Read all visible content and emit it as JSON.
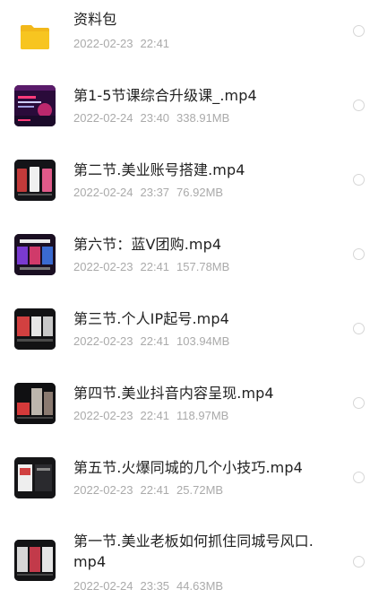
{
  "files": [
    {
      "name": "资料包",
      "date": "2022-02-23",
      "time": "22:41",
      "size": "",
      "type": "folder",
      "icon": "folder-icon",
      "selected": false
    },
    {
      "name": "第1-5节课综合升级课_.mp4",
      "date": "2022-02-24",
      "time": "23:40",
      "size": "338.91MB",
      "type": "video",
      "icon": "video-thumbnail",
      "selected": false
    },
    {
      "name": "第二节.美业账号搭建.mp4",
      "date": "2022-02-24",
      "time": "23:37",
      "size": "76.92MB",
      "type": "video",
      "icon": "video-thumbnail",
      "selected": false
    },
    {
      "name": "第六节：蓝V团购.mp4",
      "date": "2022-02-23",
      "time": "22:41",
      "size": "157.78MB",
      "type": "video",
      "icon": "video-thumbnail",
      "selected": false
    },
    {
      "name": "第三节.个人IP起号.mp4",
      "date": "2022-02-23",
      "time": "22:41",
      "size": "103.94MB",
      "type": "video",
      "icon": "video-thumbnail",
      "selected": false
    },
    {
      "name": "第四节.美业抖音内容呈现.mp4",
      "date": "2022-02-23",
      "time": "22:41",
      "size": "118.97MB",
      "type": "video",
      "icon": "video-thumbnail",
      "selected": false
    },
    {
      "name": "第五节.火爆同城的几个小技巧.mp4",
      "date": "2022-02-23",
      "time": "22:41",
      "size": "25.72MB",
      "type": "video",
      "icon": "video-thumbnail",
      "selected": false
    },
    {
      "name": "第一节.美业老板如何抓住同城号风口.mp4",
      "date": "2022-02-24",
      "time": "23:35",
      "size": "44.63MB",
      "type": "video",
      "icon": "video-thumbnail",
      "selected": false
    }
  ],
  "colors": {
    "folder": "#f7c520",
    "text": "#222222",
    "meta": "#aaaaaa",
    "radio_border": "#d6d6d6",
    "thumb_bg": "#17181c"
  }
}
